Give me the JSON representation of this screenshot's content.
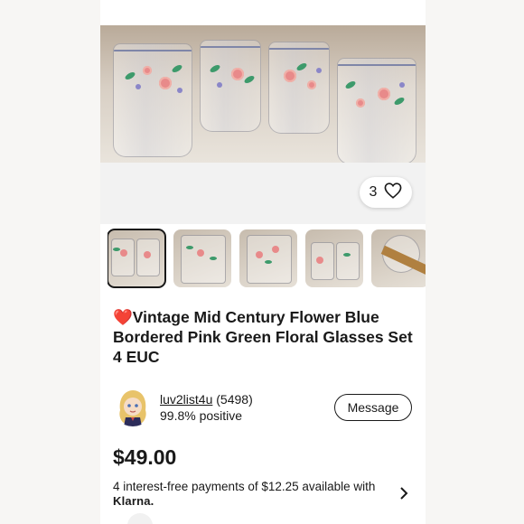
{
  "listing": {
    "like_count": "3",
    "title": "❤️Vintage Mid Century Flower Blue Bordered Pink Green Floral Glasses Set 4 EUC",
    "thumbnail_count": 5,
    "active_thumbnail": 1
  },
  "seller": {
    "username": "luv2list4u",
    "rating_count": "(5498)",
    "positive": "99.8% positive",
    "message_label": "Message"
  },
  "pricing": {
    "price": "$49.00",
    "installments_text": "4 interest-free payments of $12.25 available with",
    "provider": "Klarna."
  },
  "icons": {
    "heart": "heart-icon",
    "chevron": "chevron-right-icon"
  },
  "colors": {
    "text": "#191919",
    "background": "#ffffff"
  }
}
